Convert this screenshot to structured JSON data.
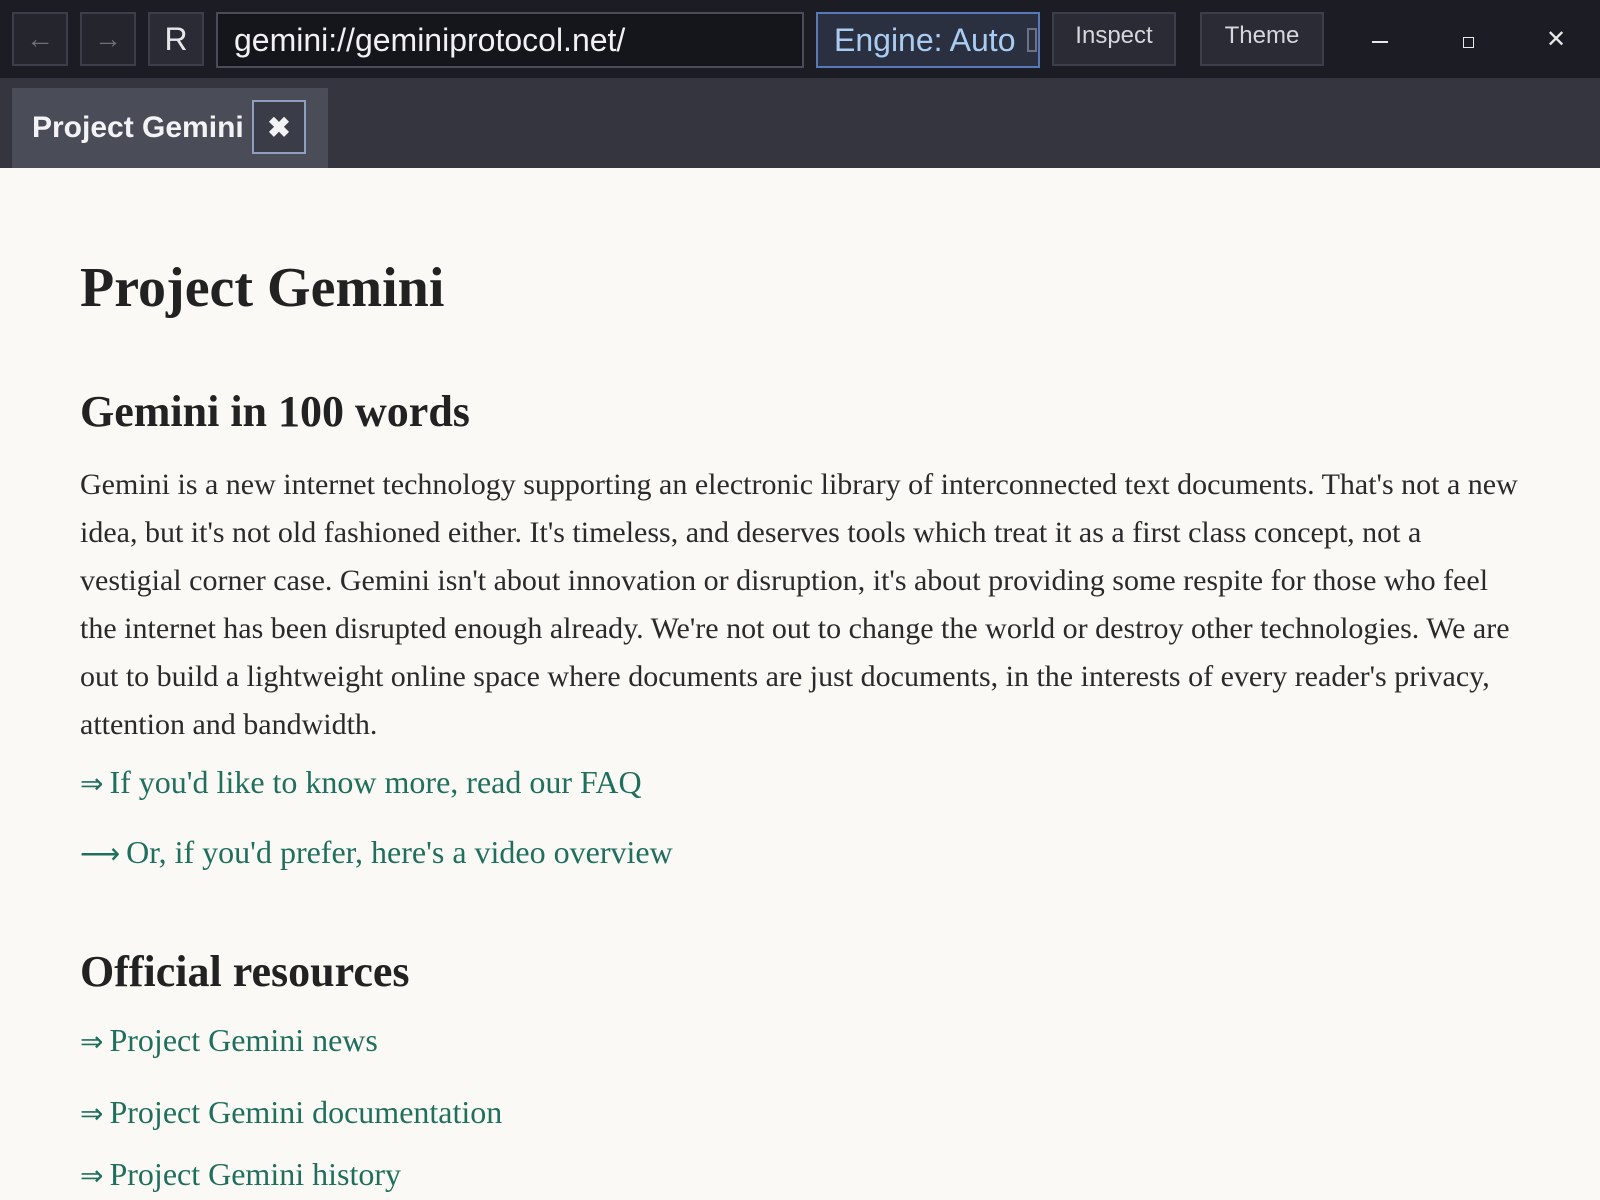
{
  "toolbar": {
    "back_icon": "←",
    "forward_icon": "→",
    "reload_label": "R",
    "url": "gemini://geminiprotocol.net/",
    "engine_label": "Engine: Auto",
    "inspect_label": "Inspect",
    "theme_label": "Theme",
    "close_icon": "✕"
  },
  "tabs": [
    {
      "label": "Project Gemini",
      "close_icon": "✖"
    }
  ],
  "page": {
    "title": "Project Gemini",
    "sections": [
      {
        "heading": "Gemini in 100 words",
        "paragraph": "Gemini is a new internet technology supporting an electronic library of interconnected text documents.  That's not a new idea, but it's not old fashioned either.  It's timeless, and deserves tools which treat it as a first class concept, not a vestigial corner case.  Gemini isn't about innovation or disruption, it's about providing some respite for those who feel the internet has been disrupted enough already.  We're not out to change the world or destroy other technologies.  We are out to build a lightweight online space where documents are just documents, in the interests of every reader's privacy, attention and bandwidth.",
        "links": [
          {
            "arrow": "⇒",
            "text": "If you'd like to know more, read our FAQ"
          },
          {
            "arrow": "⟶",
            "text": "Or, if you'd prefer, here's a video overview"
          }
        ]
      },
      {
        "heading": "Official resources",
        "links": [
          {
            "arrow": "⇒",
            "text": "Project Gemini news"
          },
          {
            "arrow": "⇒",
            "text": "Project Gemini documentation"
          },
          {
            "arrow": "⇒",
            "text": "Project Gemini history"
          }
        ]
      }
    ]
  }
}
